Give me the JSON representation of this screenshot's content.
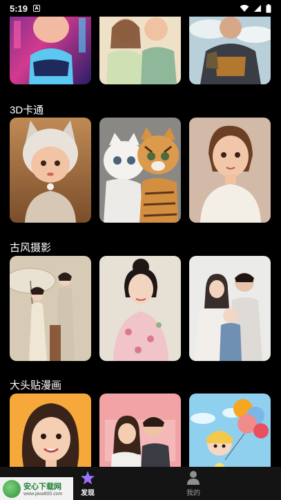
{
  "status_bar": {
    "time": "5:19",
    "app_badge": "A"
  },
  "sections": [
    {
      "title": ""
    },
    {
      "title": "3D卡通"
    },
    {
      "title": "古风摄影"
    },
    {
      "title": "大头贴漫画"
    }
  ],
  "bottom_nav": {
    "items": [
      {
        "label": "发现",
        "icon": "sparkle-star-icon",
        "active": true
      },
      {
        "label": "我的",
        "icon": "person-icon",
        "active": false
      }
    ]
  },
  "watermark": {
    "title": "安心下载网",
    "url": "www.java800.com",
    "logo_text": "安心 下载"
  },
  "colors": {
    "background": "#000000",
    "nav_background": "#141414",
    "accent_gradient_start": "#6b8cff",
    "accent_gradient_end": "#c45bff"
  }
}
